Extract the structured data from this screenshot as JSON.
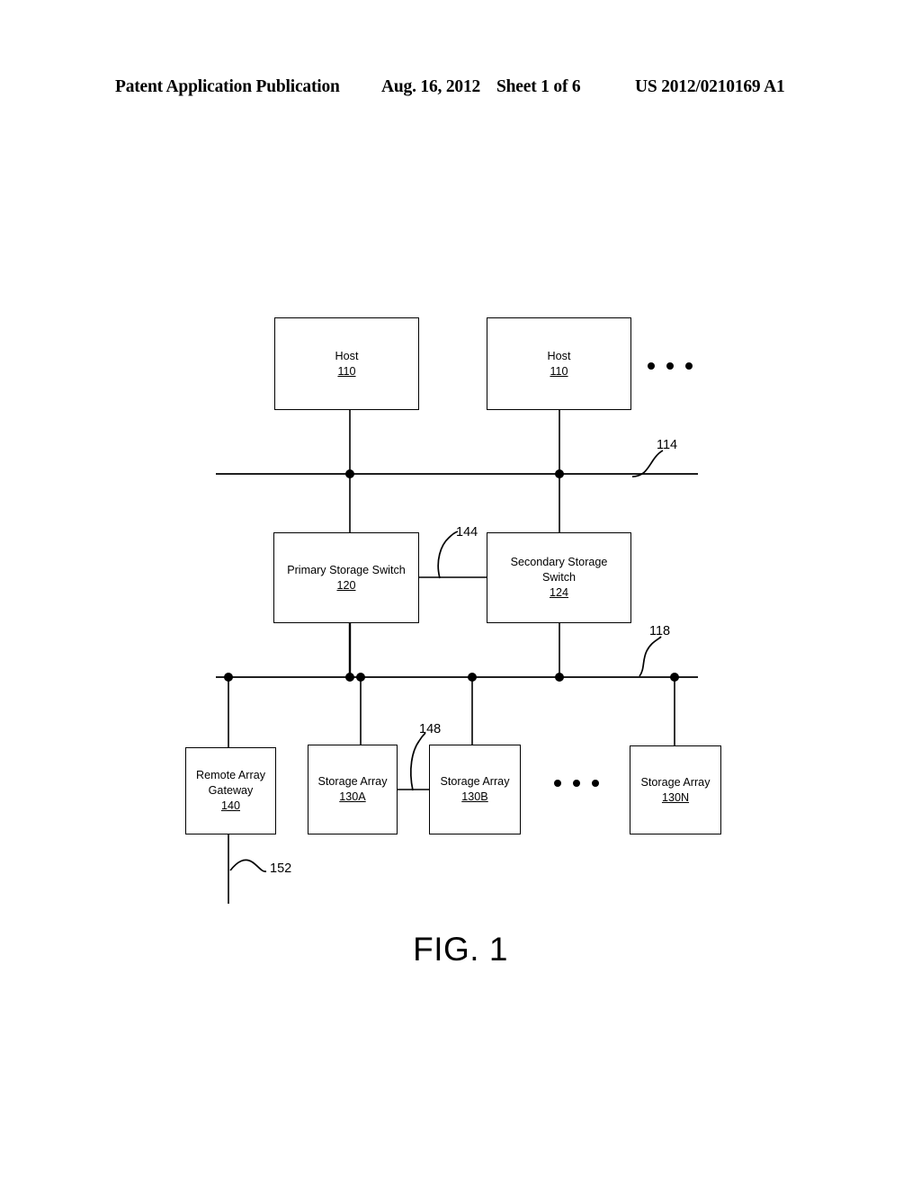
{
  "header": {
    "publication": "Patent Application Publication",
    "date": "Aug. 16, 2012",
    "sheet": "Sheet 1 of 6",
    "document_number": "US 2012/0210169 A1"
  },
  "figure": {
    "caption": "FIG. 1",
    "nodes": {
      "host_1": {
        "label": "Host",
        "refnum": "110"
      },
      "host_2": {
        "label": "Host",
        "refnum": "110"
      },
      "primary_switch": {
        "label": "Primary Storage Switch",
        "refnum": "120"
      },
      "secondary_switch": {
        "label": "Secondary Storage\nSwitch",
        "refnum": "124"
      },
      "remote_gateway": {
        "label": "Remote Array\nGateway",
        "refnum": "140"
      },
      "storage_array_a": {
        "label": "Storage Array",
        "refnum": "130A"
      },
      "storage_array_b": {
        "label": "Storage Array",
        "refnum": "130B"
      },
      "storage_array_n": {
        "label": "Storage Array",
        "refnum": "130N"
      }
    },
    "callouts": {
      "host_bus": "114",
      "switch_link": "144",
      "storage_bus": "118",
      "array_link": "148",
      "remote_link": "152"
    },
    "colors": {
      "line": "#000000",
      "background": "#ffffff"
    }
  }
}
